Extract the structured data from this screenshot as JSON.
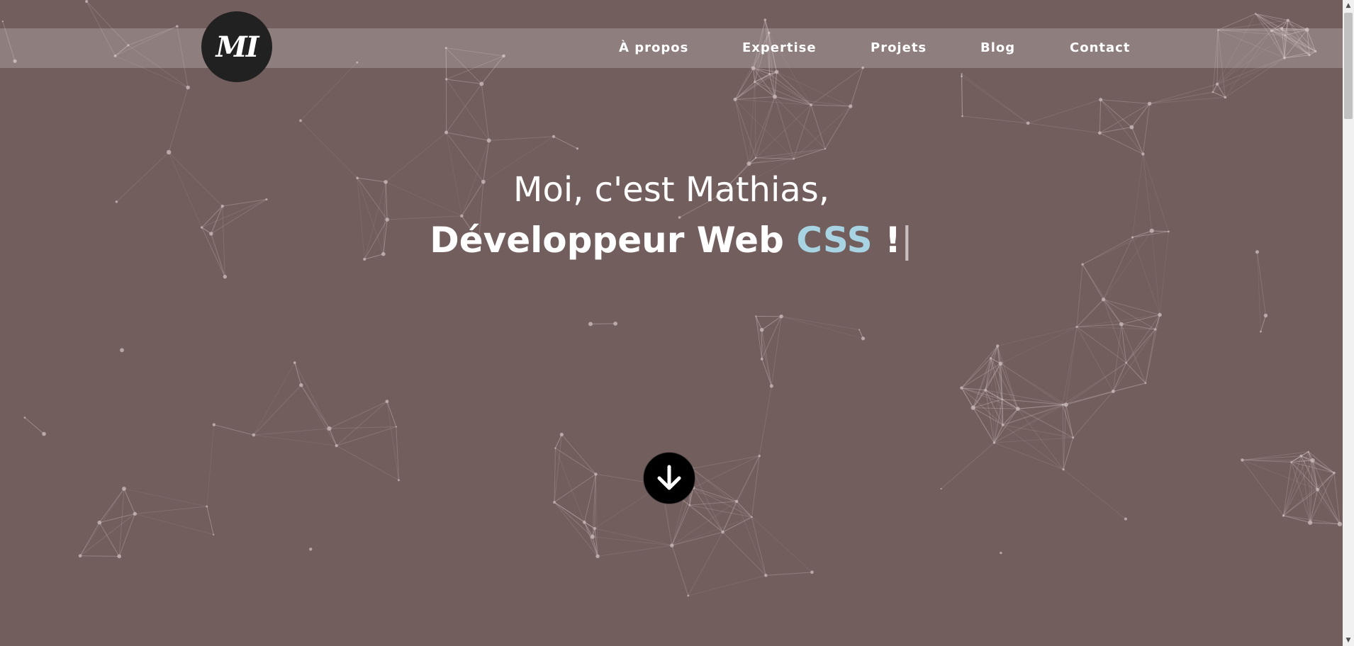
{
  "header": {
    "logo_text": "MI",
    "nav": [
      {
        "label": "À propos"
      },
      {
        "label": "Expertise"
      },
      {
        "label": "Projets"
      },
      {
        "label": "Blog"
      },
      {
        "label": "Contact"
      }
    ]
  },
  "hero": {
    "line1": "Moi, c'est Mathias,",
    "line2_prefix": "Développeur Web ",
    "line2_highlight": "CSS",
    "line2_suffix": " !",
    "cursor": "|"
  },
  "scroll_button_icon": "arrow-down-icon",
  "colors": {
    "background": "#735e5e",
    "navbar": "rgba(255,255,255,0.2)",
    "logo_bg": "#212121",
    "accent": "#a8d3e3",
    "network": "#c9b8b8"
  }
}
